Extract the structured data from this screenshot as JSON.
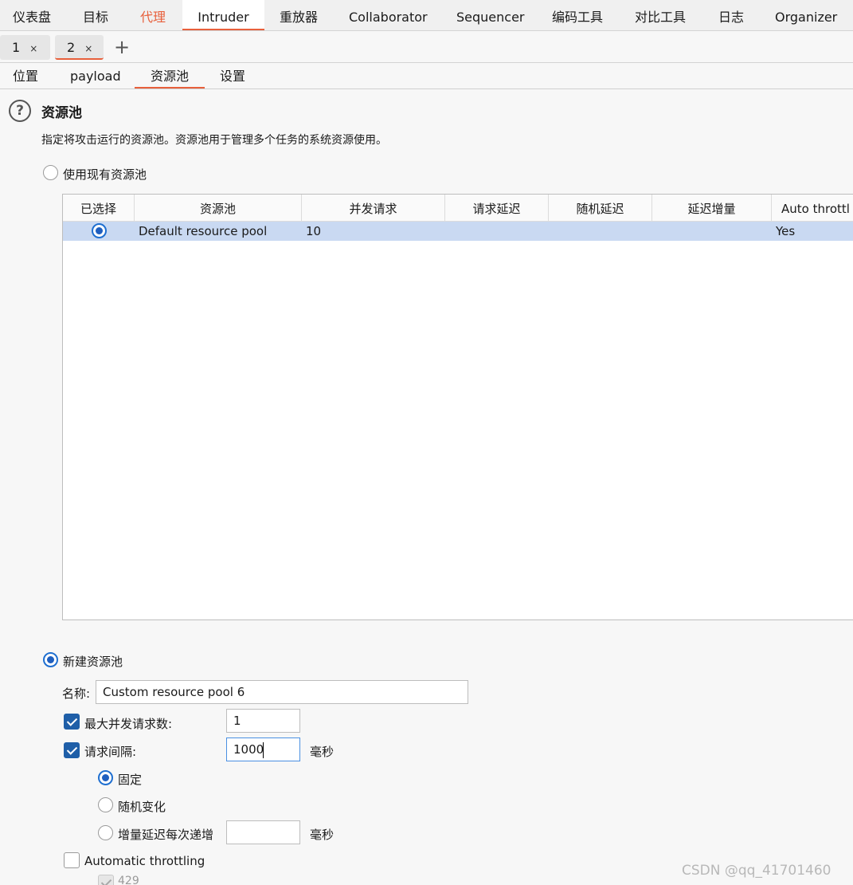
{
  "top_tabs": [
    {
      "label": "仪表盘"
    },
    {
      "label": "目标"
    },
    {
      "label": "代理"
    },
    {
      "label": "Intruder"
    },
    {
      "label": "重放器"
    },
    {
      "label": "Collaborator"
    },
    {
      "label": "Sequencer"
    },
    {
      "label": "编码工具"
    },
    {
      "label": "对比工具"
    },
    {
      "label": "日志"
    },
    {
      "label": "Organizer"
    }
  ],
  "sub_tabs": [
    {
      "label": "1",
      "close": "×"
    },
    {
      "label": "2",
      "close": "×"
    }
  ],
  "add_tab_glyph": "+",
  "inner_tabs": [
    {
      "label": "位置"
    },
    {
      "label": "payload"
    },
    {
      "label": "资源池"
    },
    {
      "label": "设置"
    }
  ],
  "section": {
    "help_glyph": "?",
    "title": "资源池",
    "description": "指定将攻击运行的资源池。资源池用于管理多个任务的系统资源使用。"
  },
  "use_existing": {
    "label": "使用现有资源池",
    "checked": false
  },
  "table": {
    "columns": [
      "已选择",
      "资源池",
      "并发请求",
      "请求延迟",
      "随机延迟",
      "延迟增量",
      "Auto throttl"
    ],
    "rows": [
      {
        "selected": true,
        "pool": "Default resource pool",
        "concurrent": "10",
        "delay": "",
        "random": "",
        "increment": "",
        "auto": "Yes"
      }
    ]
  },
  "new_pool": {
    "label": "新建资源池",
    "checked": true,
    "name_label": "名称:",
    "name_value": "Custom resource pool 6",
    "max_concurrent": {
      "label": "最大并发请求数:",
      "checked": true,
      "value": "1"
    },
    "request_interval": {
      "label": "请求间隔:",
      "checked": true,
      "value": "1000",
      "unit": "毫秒"
    },
    "interval_modes": [
      {
        "label": "固定",
        "checked": true
      },
      {
        "label": "随机变化",
        "checked": false
      },
      {
        "label": "增量延迟每次递增",
        "checked": false,
        "value": "",
        "unit": "毫秒"
      }
    ],
    "automatic_throttling": {
      "label": "Automatic throttling",
      "checked": false
    },
    "throttle_code": {
      "label": "429",
      "checked": true
    }
  },
  "watermark": "CSDN @qq_41701460",
  "colors": {
    "accent": "#e8603c",
    "selection": "#c9d9f2",
    "check_blue": "#1f5fa8"
  }
}
